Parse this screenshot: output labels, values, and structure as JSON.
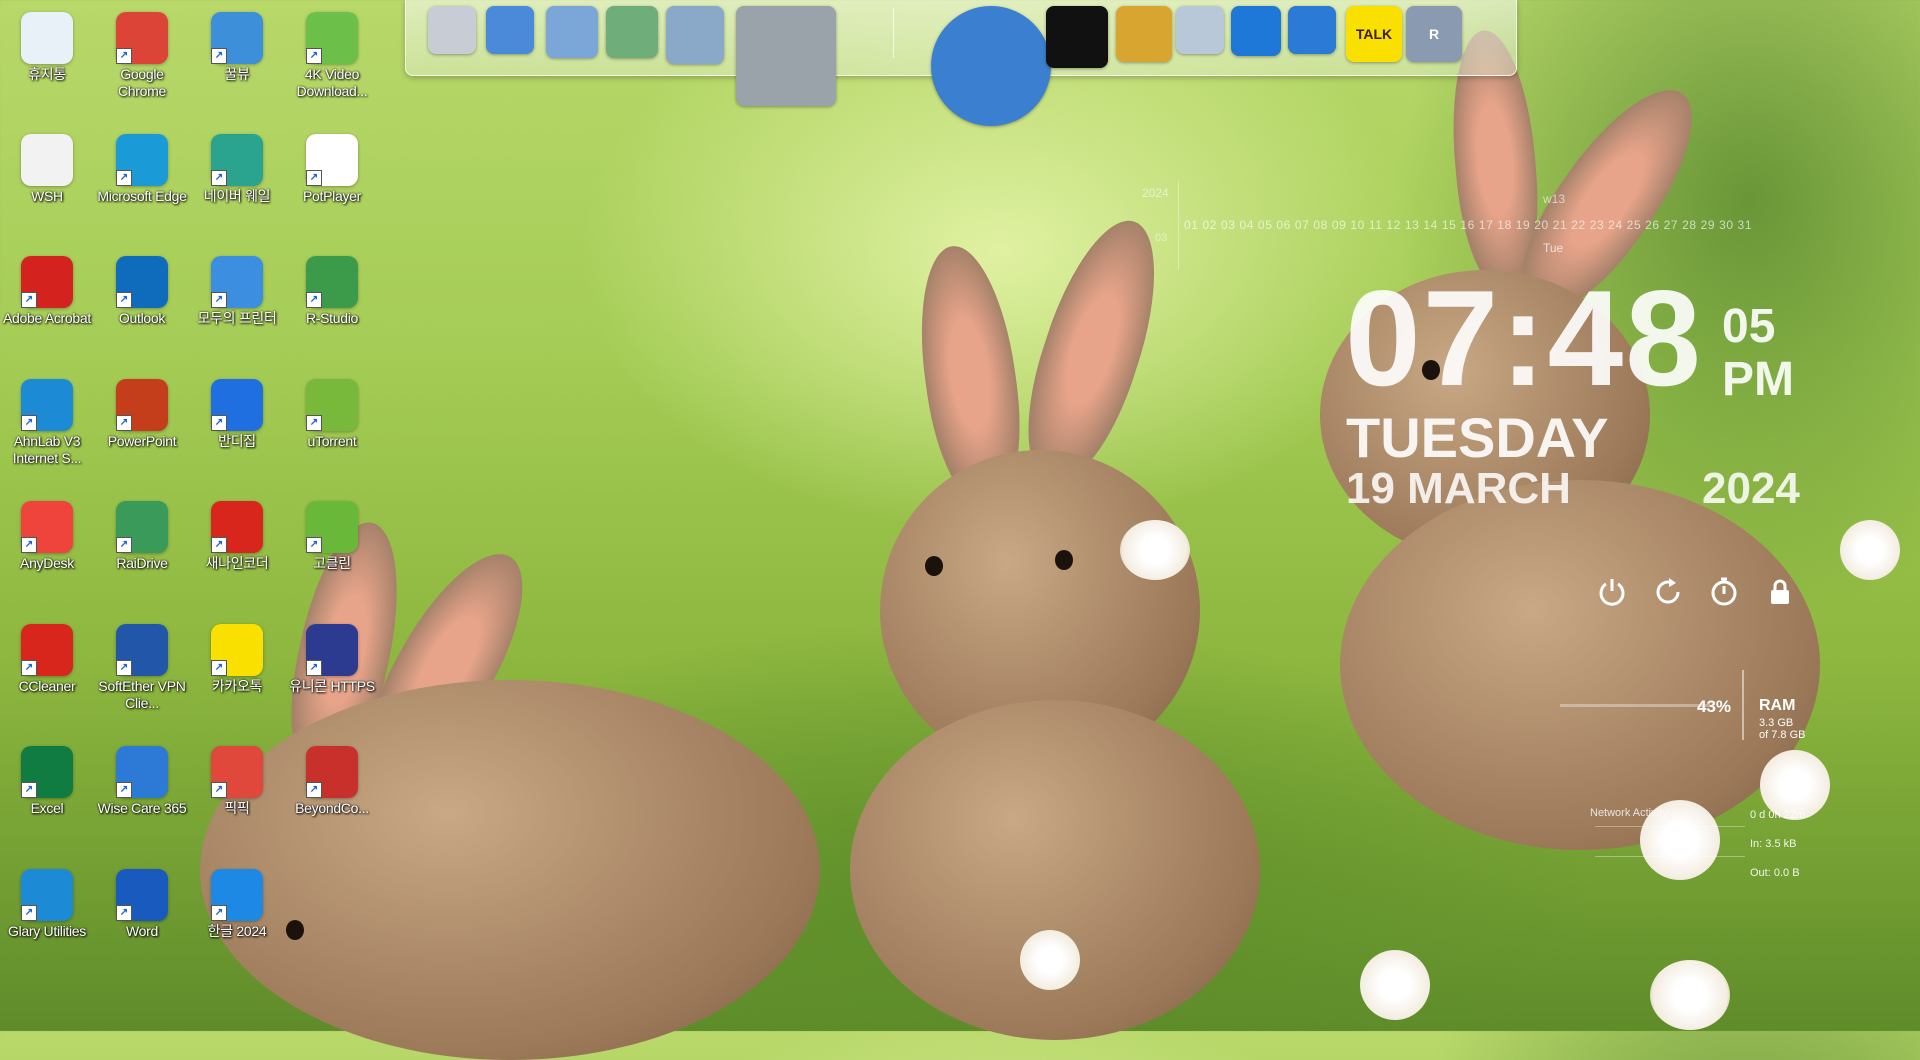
{
  "desktop_icons": [
    {
      "label": "휴지통",
      "icon": "recycle-bin-icon",
      "color": "#e8f0f8"
    },
    {
      "label": "Google Chrome",
      "icon": "chrome-icon",
      "color": "#db4437"
    },
    {
      "label": "꿀뷰",
      "icon": "honeyview-icon",
      "color": "#3c8fd8"
    },
    {
      "label": "4K Video Download...",
      "icon": "4k-downloader-icon",
      "color": "#6cc04a"
    },
    {
      "label": "WSH",
      "icon": "file-icon",
      "color": "#f2f2f2"
    },
    {
      "label": "Microsoft Edge",
      "icon": "edge-icon",
      "color": "#1a9ad6"
    },
    {
      "label": "네이버 웨일",
      "icon": "whale-icon",
      "color": "#2aa38f"
    },
    {
      "label": "PotPlayer",
      "icon": "potplayer-icon",
      "color": "#ffffff"
    },
    {
      "label": "Adobe Acrobat",
      "icon": "acrobat-icon",
      "color": "#d4231f"
    },
    {
      "label": "Outlook",
      "icon": "outlook-icon",
      "color": "#0f6cbd"
    },
    {
      "label": "모두의 프린터",
      "icon": "printer-icon",
      "color": "#3b8ee0"
    },
    {
      "label": "R-Studio",
      "icon": "rstudio-icon",
      "color": "#3c9b4a"
    },
    {
      "label": "AhnLab V3 Internet S...",
      "icon": "ahnlab-icon",
      "color": "#1d8ad6"
    },
    {
      "label": "PowerPoint",
      "icon": "powerpoint-icon",
      "color": "#c43e1c"
    },
    {
      "label": "반디집",
      "icon": "bandizip-icon",
      "color": "#1f6fe0"
    },
    {
      "label": "uTorrent",
      "icon": "utorrent-icon",
      "color": "#78b83a"
    },
    {
      "label": "AnyDesk",
      "icon": "anydesk-icon",
      "color": "#ef443b"
    },
    {
      "label": "RaiDrive",
      "icon": "raidrive-icon",
      "color": "#3a9a5a"
    },
    {
      "label": "새나인코더",
      "icon": "encoder-icon",
      "color": "#d8261c"
    },
    {
      "label": "고클린",
      "icon": "goclean-icon",
      "color": "#6ab83a"
    },
    {
      "label": "CCleaner",
      "icon": "ccleaner-icon",
      "color": "#d8261c"
    },
    {
      "label": "SoftEther VPN Clie...",
      "icon": "softether-icon",
      "color": "#2256a8"
    },
    {
      "label": "카카오톡",
      "icon": "kakaotalk-icon",
      "color": "#f9e000"
    },
    {
      "label": "유니콘 HTTPS",
      "icon": "unicorn-https-icon",
      "color": "#2c3b8f"
    },
    {
      "label": "Excel",
      "icon": "excel-icon",
      "color": "#107c41"
    },
    {
      "label": "Wise Care 365",
      "icon": "wisecare-icon",
      "color": "#2d7ad6"
    },
    {
      "label": "픽픽",
      "icon": "picpick-icon",
      "color": "#e0483c"
    },
    {
      "label": "BeyondCo...",
      "icon": "beyondcompare-icon",
      "color": "#c8302c"
    },
    {
      "label": "Glary Utilities",
      "icon": "glary-icon",
      "color": "#1d8ad6"
    },
    {
      "label": "Word",
      "icon": "word-icon",
      "color": "#185abd"
    },
    {
      "label": "한글 2024",
      "icon": "hwp-icon",
      "color": "#1e88e5"
    }
  ],
  "dock": {
    "items": [
      {
        "icon": "computer-icon"
      },
      {
        "icon": "network-icon"
      },
      {
        "icon": "folder-icon"
      },
      {
        "icon": "folder-green-icon"
      },
      {
        "icon": "folder-open-icon"
      },
      {
        "icon": "tools-icon"
      },
      {
        "icon": "globe-icon"
      },
      {
        "icon": "tshirt-icon"
      },
      {
        "icon": "hammer-icon"
      },
      {
        "icon": "trash-icon"
      },
      {
        "icon": "glary-moon-icon"
      },
      {
        "icon": "wise-shield-icon"
      },
      {
        "icon": "kakaotalk-icon",
        "text": "TALK"
      },
      {
        "icon": "rstudio-dock-icon",
        "text": "R"
      }
    ]
  },
  "calendar": {
    "year": "2024",
    "month": "03",
    "days": "01 02 03 04 05 06 07 08 09 10 11 12 13 14 15 16 17 18 19 20 21 22 23 24 25 26 27 28 29 30 31",
    "week": "w13",
    "day_of_week": "Tue"
  },
  "clock": {
    "time": "07:48",
    "seconds": "05",
    "ampm": "PM",
    "weekday": "TUESDAY",
    "date": "19 MARCH",
    "year": "2024"
  },
  "ram": {
    "percent": "43%",
    "title": "RAM",
    "used": "3.3 GB",
    "total": "of 7.8 GB"
  },
  "network": {
    "title": "Network Activity",
    "uptime": "0 d 0h 22m",
    "in": "In: 3.5 kB",
    "out": "Out: 0.0 B"
  }
}
